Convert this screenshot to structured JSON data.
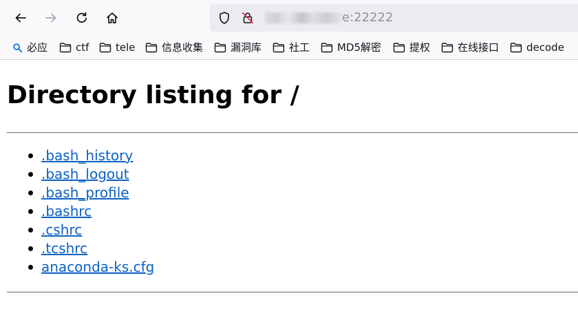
{
  "browser": {
    "url_host_suffix": "e:22222",
    "bookmarks": [
      {
        "label": "必应",
        "icon": "search-icon"
      },
      {
        "label": "ctf",
        "icon": "folder-icon"
      },
      {
        "label": "tele",
        "icon": "folder-icon"
      },
      {
        "label": "信息收集",
        "icon": "folder-icon"
      },
      {
        "label": "漏洞库",
        "icon": "folder-icon"
      },
      {
        "label": "社工",
        "icon": "folder-icon"
      },
      {
        "label": "MD5解密",
        "icon": "folder-icon"
      },
      {
        "label": "提权",
        "icon": "folder-icon"
      },
      {
        "label": "在线接口",
        "icon": "folder-icon"
      },
      {
        "label": "decode",
        "icon": "folder-icon"
      }
    ]
  },
  "page": {
    "heading": "Directory listing for /",
    "files": [
      ".bash_history",
      ".bash_logout",
      ".bash_profile",
      ".bashrc",
      ".cshrc",
      ".tcshrc",
      "anaconda-ks.cfg"
    ]
  },
  "colors": {
    "link": "#0b61c4",
    "toolbar_bg": "#f9f9fb",
    "urlbar_bg": "#ececf0",
    "bing_accent": "#1a73e8"
  }
}
